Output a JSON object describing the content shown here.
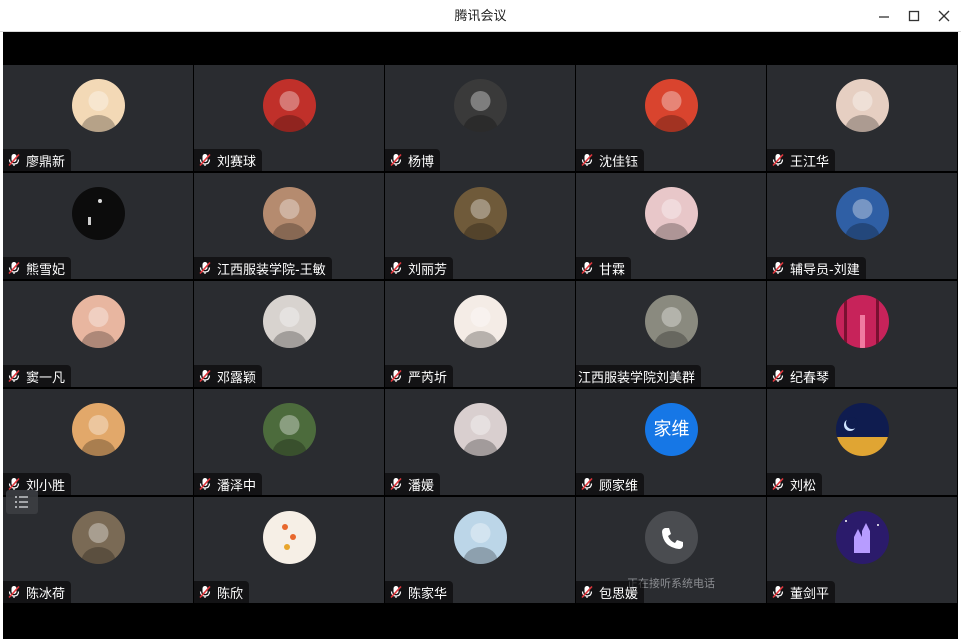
{
  "window": {
    "title": "腾讯会议"
  },
  "participants": [
    {
      "name": "廖鼎新",
      "avatar": "cartoon-kid-avatar",
      "color": "#f3d9b6"
    },
    {
      "name": "刘赛球",
      "avatar": "red-car-avatar",
      "color": "#c0302a"
    },
    {
      "name": "杨博",
      "avatar": "man-black-coat-avatar",
      "color": "#3a3a3a"
    },
    {
      "name": "沈佳钰",
      "avatar": "mother-baby-avatar",
      "color": "#d9442e"
    },
    {
      "name": "王江华",
      "avatar": "baby-photo-avatar",
      "color": "#e6cfc2"
    },
    {
      "name": "熊雪妃",
      "avatar": "night-moon-avatar",
      "color": "#0c0c0c"
    },
    {
      "name": "江西服装学院-王敏",
      "avatar": "cat-avatar",
      "color": "#b58b6f"
    },
    {
      "name": "刘丽芳",
      "avatar": "bookshelf-avatar",
      "color": "#6f5a3a"
    },
    {
      "name": "甘霖",
      "avatar": "girl-portrait-avatar",
      "color": "#e8c7c9"
    },
    {
      "name": "辅导员-刘建",
      "avatar": "child-blue-avatar",
      "color": "#2f5fa5"
    },
    {
      "name": "窦一凡",
      "avatar": "girl-smile-avatar",
      "color": "#e8b6a0"
    },
    {
      "name": "邓露颖",
      "avatar": "anime-girl-avatar",
      "color": "#d8d3cf"
    },
    {
      "name": "严芮圻",
      "avatar": "illustration-girl-avatar",
      "color": "#f4ece6"
    },
    {
      "name": "江西服装学院刘美群",
      "avatar": "man-portrait-avatar",
      "color": "#8a8a7f",
      "muted_icon": false
    },
    {
      "name": "纪春琴",
      "avatar": "pink-forest-avatar",
      "color": "#c7235a"
    },
    {
      "name": "刘小胜",
      "avatar": "puppy-avatar",
      "color": "#e2a86a"
    },
    {
      "name": "潘泽中",
      "avatar": "pagoda-avatar",
      "color": "#4c6b3c"
    },
    {
      "name": "潘媛",
      "avatar": "woman-portrait-avatar",
      "color": "#d9cfcf"
    },
    {
      "name": "顾家维",
      "avatar": "text-avatar",
      "avatar_text": "家维",
      "color": "#1677e6"
    },
    {
      "name": "刘松",
      "avatar": "moon-night-avatar",
      "color": "#1a3a8a"
    },
    {
      "name": "陈冰荷",
      "avatar": "deer-avatar",
      "color": "#7a6a55"
    },
    {
      "name": "陈欣",
      "avatar": "flower-avatar",
      "color": "#f6efe6"
    },
    {
      "name": "陈家华",
      "avatar": "cartoon-couple-avatar",
      "color": "#bcd6e8"
    },
    {
      "name": "包思媛",
      "avatar": "phone-avatar",
      "color": "#4a4c50",
      "caption": "正在接听系统电话"
    },
    {
      "name": "董剑平",
      "avatar": "castle-night-avatar",
      "color": "#2b1b6b"
    }
  ],
  "colors": {
    "tile_bg": "#2a2c30",
    "mic_muted": "#e0363c"
  }
}
